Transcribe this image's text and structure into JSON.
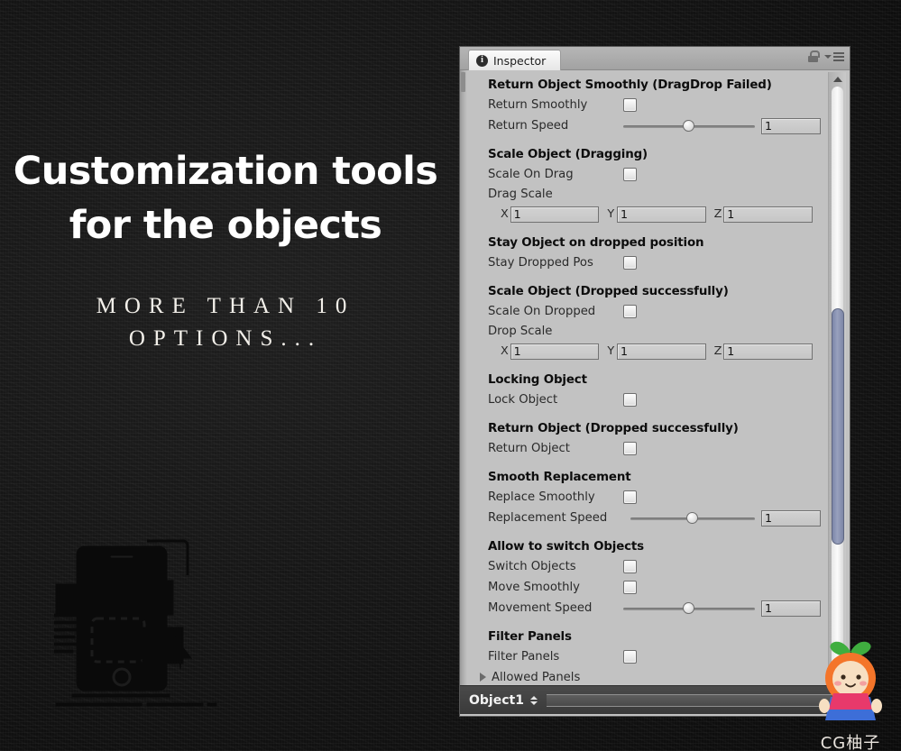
{
  "promo": {
    "headline_line1": "Customization tools",
    "headline_line2": "for the objects",
    "subline1": "MORE THAN 10",
    "subline2": "OPTIONS..."
  },
  "inspector": {
    "tab_label": "Inspector",
    "tab_icon": "info-icon",
    "lock_icon": "lock-icon",
    "menu_icon": "menu-icon",
    "footer_object": "Object1",
    "groups": [
      {
        "title": "Return Object Smoothly (DragDrop Failed)",
        "rows": [
          {
            "type": "checkbox",
            "label": "Return Smoothly",
            "checked": false
          },
          {
            "type": "slider",
            "label": "Return Speed",
            "value": "1",
            "handle_pct": 45
          }
        ]
      },
      {
        "title": "Scale Object (Dragging)",
        "rows": [
          {
            "type": "checkbox",
            "label": "Scale On Drag",
            "checked": false
          },
          {
            "type": "sublabel",
            "label": "Drag Scale"
          },
          {
            "type": "vector3",
            "x_axis": "X",
            "y_axis": "Y",
            "z_axis": "Z",
            "x": "1",
            "y": "1",
            "z": "1"
          }
        ]
      },
      {
        "title": "Stay Object on dropped position",
        "rows": [
          {
            "type": "checkbox",
            "label": "Stay Dropped Pos",
            "checked": false
          }
        ]
      },
      {
        "title": "Scale Object (Dropped successfully)",
        "rows": [
          {
            "type": "checkbox",
            "label": "Scale On Dropped",
            "checked": false
          },
          {
            "type": "sublabel",
            "label": "Drop Scale"
          },
          {
            "type": "vector3",
            "x_axis": "X",
            "y_axis": "Y",
            "z_axis": "Z",
            "x": "1",
            "y": "1",
            "z": "1"
          }
        ]
      },
      {
        "title": "Locking Object",
        "rows": [
          {
            "type": "checkbox",
            "label": "Lock Object",
            "checked": false
          }
        ]
      },
      {
        "title": "Return Object (Dropped successfully)",
        "rows": [
          {
            "type": "checkbox",
            "label": "Return Object",
            "checked": false
          }
        ]
      },
      {
        "title": "Smooth Replacement",
        "rows": [
          {
            "type": "checkbox",
            "label": "Replace Smoothly",
            "checked": false
          },
          {
            "type": "slider",
            "label": "Replacement Speed",
            "value": "1",
            "handle_pct": 45
          }
        ]
      },
      {
        "title": "Allow to switch Objects",
        "rows": [
          {
            "type": "checkbox",
            "label": "Switch Objects",
            "checked": false
          },
          {
            "type": "checkbox",
            "label": "Move Smoothly",
            "checked": false
          },
          {
            "type": "slider",
            "label": "Movement Speed",
            "value": "1",
            "handle_pct": 45
          }
        ]
      },
      {
        "title": "Filter Panels",
        "rows": [
          {
            "type": "checkbox",
            "label": "Filter Panels",
            "checked": false
          },
          {
            "type": "foldout",
            "label": "Allowed Panels",
            "expanded": false
          }
        ]
      }
    ]
  },
  "watermark": {
    "text": "CG柚子"
  },
  "colors": {
    "background": "#181818",
    "panel": "#c2c2c2",
    "footer": "#3f3f3f",
    "scroll_thumb": "#8a93b0",
    "text_light": "#ffffff"
  }
}
